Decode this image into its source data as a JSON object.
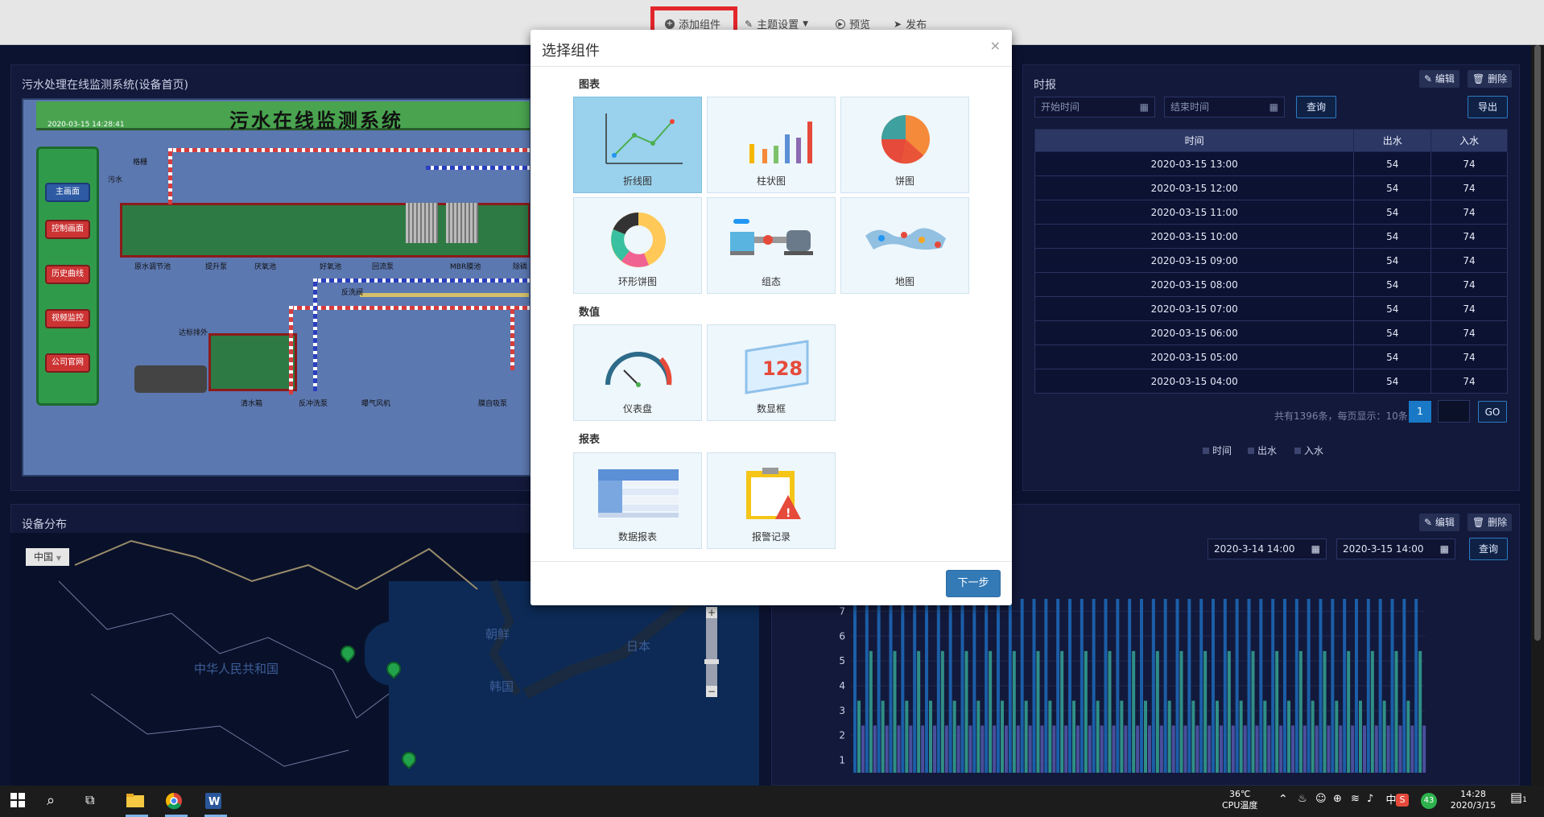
{
  "toolbar": {
    "add_component": "添加组件",
    "theme_settings": "主题设置",
    "preview": "预览",
    "publish": "发布"
  },
  "scada_panel": {
    "title": "污水处理在线监测系统(设备首页)",
    "image_title": "污水在线监测系统",
    "image_time": "2020-03-15 14:28:41",
    "menu": [
      "主画面",
      "控制画面",
      "历史曲线",
      "视频监控",
      "公司官网"
    ],
    "labels": [
      "原水调节池",
      "提升泵",
      "厌氧池",
      "好氧池",
      "回流泵",
      "MBR膜池",
      "除磷",
      "清水箱",
      "反冲洗泵",
      "曝气风机",
      "膜自吸泵",
      "反洗阀",
      "达标排外",
      "污水",
      "格栅"
    ]
  },
  "report_panel": {
    "title": "时报",
    "edit": "编辑",
    "delete": "删除",
    "start_placeholder": "开始时间",
    "end_placeholder": "结束时间",
    "query": "查询",
    "export": "导出",
    "columns": [
      "时间",
      "出水",
      "入水"
    ],
    "rows": [
      [
        "2020-03-15 13:00",
        "54",
        "74"
      ],
      [
        "2020-03-15 12:00",
        "54",
        "74"
      ],
      [
        "2020-03-15 11:00",
        "54",
        "74"
      ],
      [
        "2020-03-15 10:00",
        "54",
        "74"
      ],
      [
        "2020-03-15 09:00",
        "54",
        "74"
      ],
      [
        "2020-03-15 08:00",
        "54",
        "74"
      ],
      [
        "2020-03-15 07:00",
        "54",
        "74"
      ],
      [
        "2020-03-15 06:00",
        "54",
        "74"
      ],
      [
        "2020-03-15 05:00",
        "54",
        "74"
      ],
      [
        "2020-03-15 04:00",
        "54",
        "74"
      ]
    ],
    "pager_text": "共有1396条，每页显示：10条",
    "current_page": "1",
    "go": "GO",
    "legend": [
      "时间",
      "出水",
      "入水"
    ]
  },
  "map_panel": {
    "title": "设备分布",
    "region_select": "中国",
    "labels": [
      "中华人民共和国",
      "朝鲜",
      "韩国",
      "日本"
    ],
    "zoom_in": "+",
    "zoom_out": "−"
  },
  "chart_panel": {
    "edit": "编辑",
    "delete": "删除",
    "start": "2020-3-14 14:00",
    "end": "2020-3-15 14:00",
    "query": "查询"
  },
  "chart_data": {
    "type": "bar",
    "yticks": [
      "1",
      "2",
      "3",
      "4",
      "5",
      "6",
      "7"
    ],
    "ylim": [
      0.5,
      7.5
    ],
    "series": [
      {
        "color": "#1b5ea8",
        "values": [
          7.5,
          7.5,
          7.5,
          7.5,
          7.5,
          7.5,
          7.5,
          7.5,
          7.5,
          7.5,
          7.5,
          7.5,
          7.5,
          7.5,
          7.5,
          7.5,
          7.5,
          7.5,
          7.5,
          7.5,
          7.5,
          7.5,
          7.5,
          7.5,
          7.5,
          7.5,
          7.5,
          7.5,
          7.5,
          7.5,
          7.5,
          7.5,
          7.5,
          7.5,
          7.5,
          7.5,
          7.5,
          7.5,
          7.5,
          7.5,
          7.5,
          7.5,
          7.5,
          7.5,
          7.5,
          7.5,
          7.5,
          7.5
        ]
      },
      {
        "color": "#2f8f86",
        "values": [
          3.4,
          5.4,
          3.4,
          5.4,
          3.4,
          5.4,
          3.4,
          5.4,
          3.4,
          5.4,
          3.4,
          5.4,
          3.4,
          5.4,
          3.4,
          5.4,
          3.4,
          5.4,
          3.4,
          5.4,
          3.4,
          5.4,
          3.4,
          5.4,
          3.4,
          5.4,
          3.4,
          5.4,
          3.4,
          5.4,
          3.4,
          5.4,
          3.4,
          5.4,
          3.4,
          5.4,
          3.4,
          5.4,
          3.4,
          5.4,
          3.4,
          5.4,
          3.4,
          5.4,
          3.4,
          5.4,
          3.4,
          5.4
        ]
      },
      {
        "color": "#4a4f9c",
        "values": [
          2.4,
          2.4,
          2.4,
          2.4,
          2.4,
          2.4,
          2.4,
          2.4,
          2.4,
          2.4,
          2.4,
          2.4,
          2.4,
          2.4,
          2.4,
          2.4,
          2.4,
          2.4,
          2.4,
          2.4,
          2.4,
          2.4,
          2.4,
          2.4,
          2.4,
          2.4,
          2.4,
          2.4,
          2.4,
          2.4,
          2.4,
          2.4,
          2.4,
          2.4,
          2.4,
          2.4,
          2.4,
          2.4,
          2.4,
          2.4,
          2.4,
          2.4,
          2.4,
          2.4,
          2.4,
          2.4,
          2.4,
          2.4
        ]
      }
    ]
  },
  "modal": {
    "title": "选择组件",
    "close": "×",
    "sections": [
      {
        "label": "图表",
        "items": [
          "折线图",
          "柱状图",
          "饼图",
          "环形饼图",
          "组态",
          "地图"
        ]
      },
      {
        "label": "数值",
        "items": [
          "仪表盘",
          "数显框"
        ]
      },
      {
        "label": "报表",
        "items": [
          "数据报表",
          "报警记录"
        ]
      }
    ],
    "digital_value": "128",
    "next": "下一步"
  },
  "taskbar": {
    "cpu_temp": "36℃",
    "cpu_label": "CPU温度",
    "ime": "中",
    "time": "14:28",
    "date": "2020/3/15",
    "badge": "43",
    "notify": "1"
  }
}
